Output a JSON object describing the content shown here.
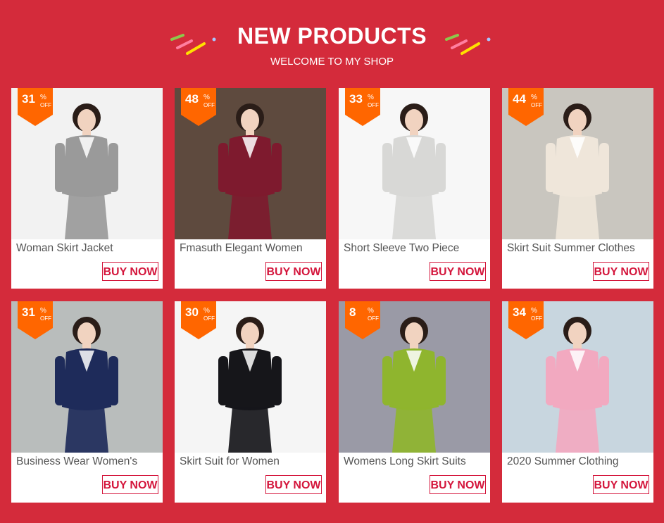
{
  "header": {
    "title": "NEW PRODUCTS",
    "subtitle": "WELCOME TO MY SHOP"
  },
  "colors": {
    "background": "#d42b3b",
    "badge": "#ff6600",
    "buy_button": "#d4163c",
    "card": "#ffffff"
  },
  "products": [
    {
      "name": "Woman Skirt Jacket",
      "discount": "31",
      "pct": "%",
      "off": "OFF",
      "buy_label": "BUY NOW",
      "suit": "#9a9a9a",
      "bg": "#f2f2f2"
    },
    {
      "name": "Fmasuth Elegant Women",
      "discount": "48",
      "pct": "%",
      "off": "OFF",
      "buy_label": "BUY NOW",
      "suit": "#7e1a2e",
      "bg": "#5e4a3e"
    },
    {
      "name": "Short Sleeve Two Piece",
      "discount": "33",
      "pct": "%",
      "off": "OFF",
      "buy_label": "BUY NOW",
      "suit": "#d8d8d6",
      "bg": "#f7f7f7"
    },
    {
      "name": "Skirt Suit Summer Clothes",
      "discount": "44",
      "pct": "%",
      "off": "OFF",
      "buy_label": "BUY NOW",
      "suit": "#efe6da",
      "bg": "#c9c6bf"
    },
    {
      "name": "Business Wear Women's",
      "discount": "31",
      "pct": "%",
      "off": "OFF",
      "buy_label": "BUY NOW",
      "suit": "#1e2b5a",
      "bg": "#b9bdbc"
    },
    {
      "name": "Skirt Suit for Women",
      "discount": "30",
      "pct": "%",
      "off": "OFF",
      "buy_label": "BUY NOW",
      "suit": "#16161a",
      "bg": "#f5f5f5"
    },
    {
      "name": "Womens Long Skirt Suits",
      "discount": "8",
      "pct": "%",
      "off": "OFF",
      "buy_label": "BUY NOW",
      "suit": "#8fb52e",
      "bg": "#9a9aa6"
    },
    {
      "name": "2020 Summer Clothing",
      "discount": "34",
      "pct": "%",
      "off": "OFF",
      "buy_label": "BUY NOW",
      "suit": "#f2a9c0",
      "bg": "#c8d6df"
    }
  ]
}
